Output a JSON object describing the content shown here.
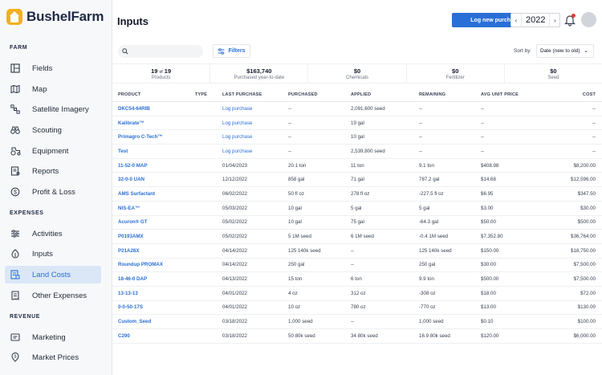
{
  "app": {
    "name": "BushelFarm"
  },
  "sidebar": {
    "sections": [
      {
        "label": "FARM",
        "items": [
          {
            "label": "Fields",
            "icon": "fields-icon"
          },
          {
            "label": "Map",
            "icon": "map-icon"
          },
          {
            "label": "Satellite Imagery",
            "icon": "satellite-icon"
          },
          {
            "label": "Scouting",
            "icon": "binoculars-icon"
          },
          {
            "label": "Equipment",
            "icon": "tractor-icon"
          },
          {
            "label": "Reports",
            "icon": "report-icon"
          },
          {
            "label": "Profit & Loss",
            "icon": "profit-icon"
          }
        ]
      },
      {
        "label": "EXPENSES",
        "items": [
          {
            "label": "Activities",
            "icon": "activities-icon"
          },
          {
            "label": "Inputs",
            "icon": "inputs-icon"
          },
          {
            "label": "Land Costs",
            "icon": "land-costs-icon",
            "active": true
          },
          {
            "label": "Other Expenses",
            "icon": "other-expenses-icon"
          }
        ]
      },
      {
        "label": "REVENUE",
        "items": [
          {
            "label": "Marketing",
            "icon": "marketing-icon"
          },
          {
            "label": "Market Prices",
            "icon": "market-prices-icon"
          }
        ]
      }
    ]
  },
  "header": {
    "title": "Inputs",
    "primary_button": "Log new purchase",
    "year": "2022"
  },
  "toolbar": {
    "search_placeholder": "",
    "filters_label": "Filters",
    "sort_label": "Sort by",
    "sort_value": "Date (new to old)"
  },
  "summary": [
    {
      "value": "19",
      "of": "of",
      "total": "19",
      "label": "Products"
    },
    {
      "value": "$163,740",
      "label": "Purchased year-to-date"
    },
    {
      "value": "$0",
      "label": "Chemicals"
    },
    {
      "value": "$0",
      "label": "Fertilizer"
    },
    {
      "value": "$0",
      "label": "Seed"
    }
  ],
  "table": {
    "columns": [
      "PRODUCT",
      "TYPE",
      "LAST PURCHASE",
      "PURCHASED",
      "APPLIED",
      "REMAINING",
      "AVG UNIT PRICE",
      "COST"
    ],
    "rows": [
      [
        "DKC54-64RIB",
        "",
        "Log purchase",
        "--",
        "2,091,600 seed",
        "--",
        "--",
        "--"
      ],
      [
        "Kalibrate™",
        "",
        "Log purchase",
        "--",
        "19 gal",
        "--",
        "--",
        "--"
      ],
      [
        "Primagro C-Tech™",
        "",
        "Log purchase",
        "--",
        "10 gal",
        "--",
        "--",
        "--"
      ],
      [
        "Test",
        "",
        "Log purchase",
        "--",
        "2,539,800 seed",
        "--",
        "--",
        "--"
      ],
      [
        "11-52-0 MAP",
        "",
        "01/04/2023",
        "20.1 ton",
        "11 ton",
        "9.1 ton",
        "$408.98",
        "$8,200.00"
      ],
      [
        "32-0-0 UAN",
        "",
        "12/12/2022",
        "858 gal",
        "71 gal",
        "787.2 gal",
        "$14.68",
        "$12,596.00"
      ],
      [
        "AMS Surfactant",
        "",
        "06/02/2022",
        "50 fl oz",
        "278 fl oz",
        "-227.5 fl oz",
        "$6.95",
        "$347.50"
      ],
      [
        "NIS-EA™",
        "",
        "05/03/2022",
        "10 gal",
        "5 gal",
        "5 gal",
        "$3.00",
        "$30.00"
      ],
      [
        "Acuron® GT",
        "",
        "05/02/2022",
        "10 gal",
        "75 gal",
        "-64.3 gal",
        "$50.00",
        "$500.00"
      ],
      [
        "P0193AMX",
        "",
        "05/02/2022",
        "5 1M seed",
        "6 1M seed",
        "-0.4 1M seed",
        "$7,352.80",
        "$36,764.00"
      ],
      [
        "P21A28X",
        "",
        "04/14/2022",
        "125 140k seed",
        "--",
        "125 140k seed",
        "$150.00",
        "$18,750.00"
      ],
      [
        "Roundup PROMAX",
        "",
        "04/14/2022",
        "250 gal",
        "--",
        "250 gal",
        "$30.00",
        "$7,500.00"
      ],
      [
        "18-46-0 DAP",
        "",
        "04/13/2022",
        "15 ton",
        "6 ton",
        "9.9 ton",
        "$500.00",
        "$7,500.00"
      ],
      [
        "13-13-13",
        "",
        "04/01/2022",
        "4 oz",
        "312 oz",
        "-308 oz",
        "$18.00",
        "$72.00"
      ],
      [
        "0-0-50-17S",
        "",
        "04/01/2022",
        "10 oz",
        "780 oz",
        "-770 oz",
        "$13.00",
        "$130.00"
      ],
      [
        "Custom_Seed",
        "",
        "03/18/2022",
        "1,000 seed",
        "--",
        "1,000 seed",
        "$0.10",
        "$100.00"
      ],
      [
        "C290",
        "",
        "03/18/2022",
        "50 80k seed",
        "34 80k seed",
        "16.9 80k seed",
        "$120.00",
        "$6,000.00"
      ]
    ]
  }
}
